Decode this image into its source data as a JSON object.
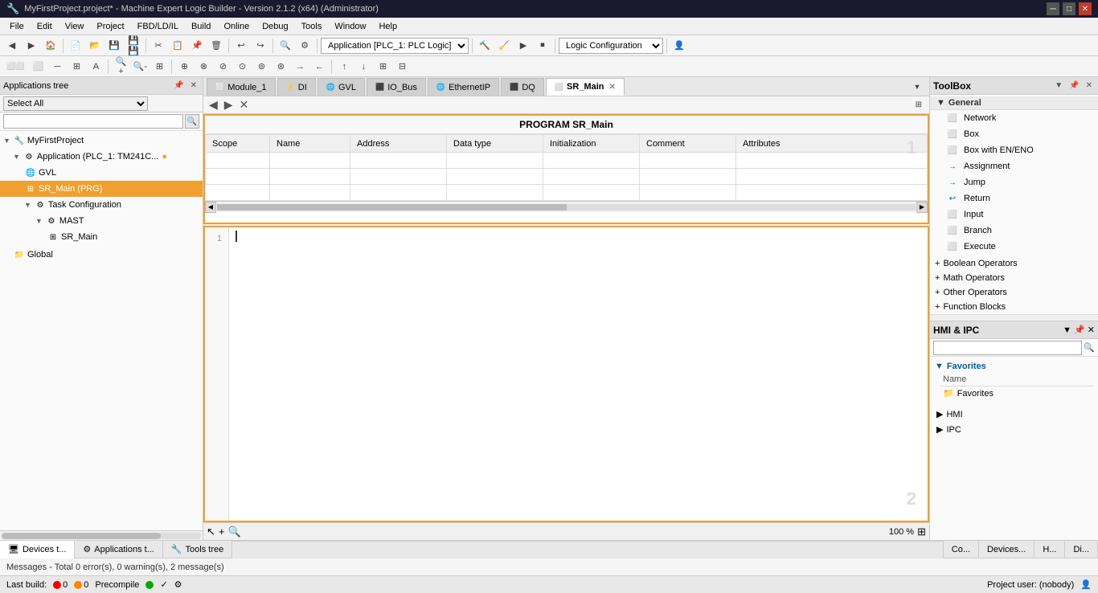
{
  "window": {
    "title": "MyFirstProject.project* - Machine Expert Logic Builder - Version 2.1.2 (x64) (Administrator)"
  },
  "menu": {
    "items": [
      "File",
      "Edit",
      "View",
      "Project",
      "FBD/LD/IL",
      "Build",
      "Online",
      "Debug",
      "Tools",
      "Window",
      "Help"
    ]
  },
  "toolbar": {
    "dropdown_label": "Application [PLC_1: PLC Logic]",
    "logic_config": "Logic Configuration"
  },
  "left_panel": {
    "title": "Applications tree",
    "select_label": "Select All",
    "tree": [
      {
        "label": "MyFirstProject",
        "level": 0,
        "type": "project",
        "expanded": true
      },
      {
        "label": "Application (PLC_1: TM241C...",
        "level": 1,
        "type": "app",
        "expanded": true
      },
      {
        "label": "GVL",
        "level": 2,
        "type": "gvl"
      },
      {
        "label": "SR_Main (PRG)",
        "level": 2,
        "type": "prg",
        "selected": true
      },
      {
        "label": "Task Configuration",
        "level": 2,
        "type": "task",
        "expanded": true
      },
      {
        "label": "MAST",
        "level": 3,
        "type": "mast",
        "expanded": true
      },
      {
        "label": "SR_Main",
        "level": 4,
        "type": "srm"
      },
      {
        "label": "Global",
        "level": 1,
        "type": "global"
      }
    ]
  },
  "tabs": [
    {
      "label": "Module_1",
      "icon": "⬜",
      "active": false
    },
    {
      "label": "DI",
      "icon": "⚡",
      "active": false
    },
    {
      "label": "GVL",
      "icon": "🌐",
      "active": false
    },
    {
      "label": "IO_Bus",
      "icon": "⬛",
      "active": false
    },
    {
      "label": "EthernetIP",
      "icon": "🌐",
      "active": false
    },
    {
      "label": "DQ",
      "icon": "⬛",
      "active": false
    },
    {
      "label": "SR_Main",
      "icon": "⬜",
      "active": true
    }
  ],
  "editor": {
    "program_title": "PROGRAM SR_Main",
    "variable_headers": [
      "Scope",
      "Name",
      "Address",
      "Data type",
      "Initialization",
      "Comment",
      "Attributes"
    ],
    "section1_number": "1",
    "section2_number": "2"
  },
  "toolbox": {
    "title": "ToolBox",
    "general_label": "General",
    "items": [
      {
        "label": "Network",
        "icon": "⬜"
      },
      {
        "label": "Box",
        "icon": "⬜"
      },
      {
        "label": "Box with EN/ENO",
        "icon": "⬜"
      },
      {
        "label": "Assignment",
        "icon": "→"
      },
      {
        "label": "Jump",
        "icon": "→"
      },
      {
        "label": "Return",
        "icon": "↩"
      },
      {
        "label": "Input",
        "icon": "⬜"
      },
      {
        "label": "Branch",
        "icon": "⬜"
      },
      {
        "label": "Execute",
        "icon": "⬜"
      }
    ],
    "groups": [
      {
        "label": "Boolean Operators",
        "expanded": false
      },
      {
        "label": "Math Operators",
        "expanded": false
      },
      {
        "label": "Other Operators",
        "expanded": false
      },
      {
        "label": "Function Blocks",
        "expanded": false
      }
    ]
  },
  "hmi_panel": {
    "title": "HMI & IPC",
    "favorites_label": "Favorites",
    "name_col": "Name",
    "favorites_item": "Favorites"
  },
  "hmi_bottom": [
    {
      "label": "HMI"
    },
    {
      "label": "IPC"
    }
  ],
  "bottom_tabs": [
    {
      "label": "Devices t...",
      "icon": "🖥"
    },
    {
      "label": "Applications t...",
      "icon": "⚙"
    },
    {
      "label": "Tools tree",
      "icon": "🔧"
    }
  ],
  "messages_bar": {
    "text": "Messages - Total 0 error(s), 0 warning(s), 2 message(s)"
  },
  "status_bar": {
    "last_build_label": "Last build:",
    "errors": "0",
    "warnings": "0",
    "precompile_label": "Precompile",
    "project_user": "Project user: (nobody)"
  },
  "zoom": {
    "level": "100 %"
  }
}
